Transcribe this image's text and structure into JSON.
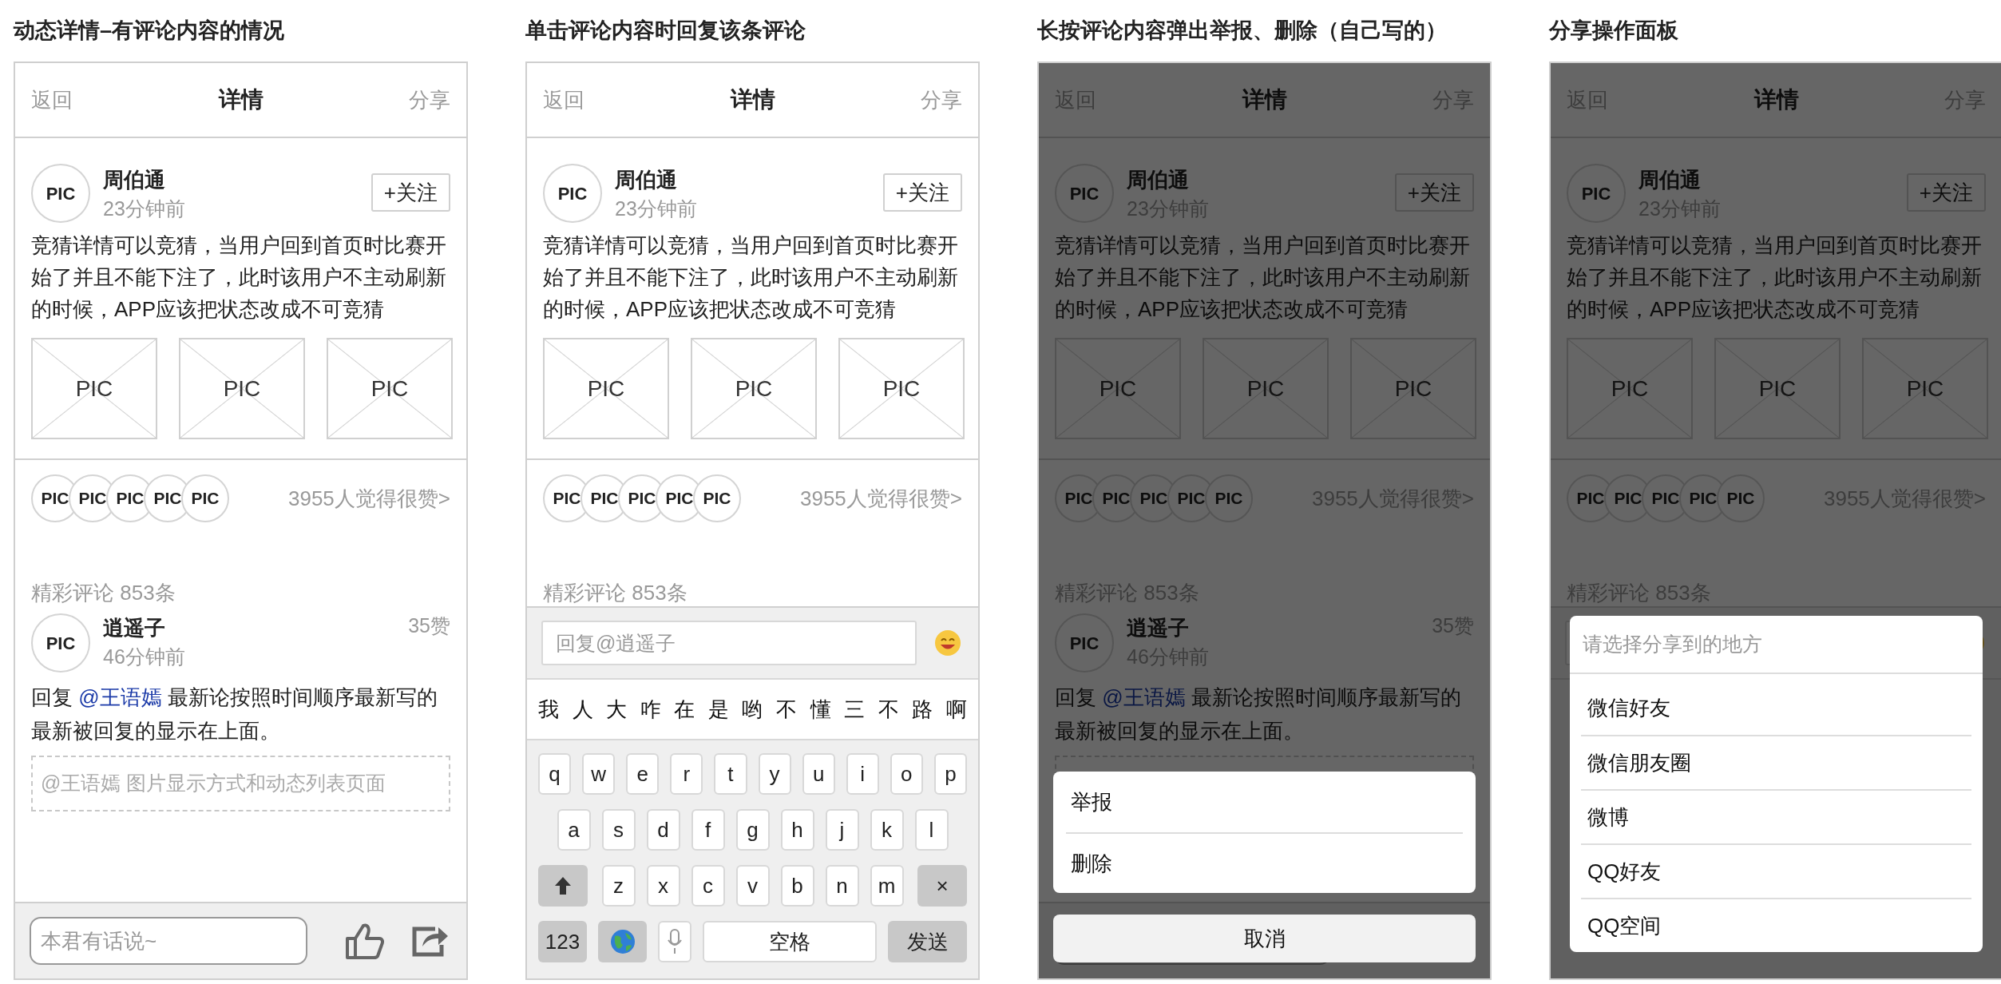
{
  "screens": [
    {
      "caption": "动态详情–有评论内容的情况",
      "nav": {
        "back": "返回",
        "title": "详情",
        "share": "分享"
      },
      "post": {
        "avatar": "PIC",
        "name": "周伯通",
        "time": "23分钟前",
        "follow": "+关注",
        "text": "竞猜详情可以竞猜，当用户回到首页时比赛开始了并且不能下注了，此时该用户不主动刷新的时候，APP应该把状态改成不可竞猜",
        "images": [
          "PIC",
          "PIC",
          "PIC"
        ]
      },
      "likes": {
        "avatars": [
          "PIC",
          "PIC",
          "PIC",
          "PIC",
          "PIC"
        ],
        "summary": "3955人觉得很赞>"
      },
      "comments_header": "精彩评论 853条",
      "comment": {
        "avatar": "PIC",
        "name": "逍遥子",
        "time": "46分钟前",
        "likes": "35赞",
        "prefix": "回复",
        "mention": "@王语嫣",
        "rest": "最新论按照时间顺序最新写的最新被回复的显示在上面。",
        "quote": "@王语嫣 图片显示方式和动态列表页面"
      },
      "bottom": {
        "kind": "comment_bar",
        "placeholder": "本君有话说~"
      }
    },
    {
      "caption": "单击评论内容时回复该条评论",
      "nav": {
        "back": "返回",
        "title": "详情",
        "share": "分享"
      },
      "post": {
        "avatar": "PIC",
        "name": "周伯通",
        "time": "23分钟前",
        "follow": "+关注",
        "text": "竞猜详情可以竞猜，当用户回到首页时比赛开始了并且不能下注了，此时该用户不主动刷新的时候，APP应该把状态改成不可竞猜",
        "images": [
          "PIC",
          "PIC",
          "PIC"
        ]
      },
      "likes": {
        "avatars": [
          "PIC",
          "PIC",
          "PIC",
          "PIC",
          "PIC"
        ],
        "summary": "3955人觉得很赞>"
      },
      "comments_header": "精彩评论 853条",
      "bottom": {
        "kind": "keyboard",
        "placeholder": "回复@逍遥子",
        "candidates": [
          "我",
          "人",
          "大",
          "咋",
          "在",
          "是",
          "哟",
          "不",
          "懂",
          "三",
          "不",
          "路",
          "啊"
        ],
        "rows": [
          [
            "q",
            "w",
            "e",
            "r",
            "t",
            "y",
            "u",
            "i",
            "o",
            "p"
          ],
          [
            "a",
            "s",
            "d",
            "f",
            "g",
            "h",
            "j",
            "k",
            "l"
          ],
          [
            "z",
            "x",
            "c",
            "v",
            "b",
            "n",
            "m"
          ]
        ],
        "delete": "×",
        "numbers": "123",
        "space": "空格",
        "send": "发送"
      }
    },
    {
      "caption": "长按评论内容弹出举报、删除（自己写的）",
      "nav": {
        "back": "返回",
        "title": "详情",
        "share": "分享"
      },
      "post": {
        "avatar": "PIC",
        "name": "周伯通",
        "time": "23分钟前",
        "follow": "+关注",
        "text": "竞猜详情可以竞猜，当用户回到首页时比赛开始了并且不能下注了，此时该用户不主动刷新的时候，APP应该把状态改成不可竞猜",
        "images": [
          "PIC",
          "PIC",
          "PIC"
        ]
      },
      "likes": {
        "avatars": [
          "PIC",
          "PIC",
          "PIC",
          "PIC",
          "PIC"
        ],
        "summary": "3955人觉得很赞>"
      },
      "comments_header": "精彩评论 853条",
      "comment": {
        "avatar": "PIC",
        "name": "逍遥子",
        "time": "46分钟前",
        "likes": "35赞",
        "prefix": "回复",
        "mention": "@王语嫣",
        "rest": "最新论按照时间顺序最新写的最新被回复的显示在上面。",
        "quote_box": true
      },
      "bottom": {
        "kind": "comment_bar"
      },
      "overlay": {
        "kind": "action_sheet",
        "items": [
          "举报",
          "删除"
        ],
        "cancel": "取消"
      }
    },
    {
      "caption": "分享操作面板",
      "nav": {
        "back": "返回",
        "title": "详情",
        "share": "分享"
      },
      "post": {
        "avatar": "PIC",
        "name": "周伯通",
        "time": "23分钟前",
        "follow": "+关注",
        "text": "竞猜详情可以竞猜，当用户回到首页时比赛开始了并且不能下注了，此时该用户不主动刷新的时候，APP应该把状态改成不可竞猜",
        "images": [
          "PIC",
          "PIC",
          "PIC"
        ]
      },
      "likes": {
        "avatars": [
          "PIC",
          "PIC",
          "PIC",
          "PIC",
          "PIC"
        ],
        "summary": "3955人觉得很赞>"
      },
      "comments_header": "精彩评论 853条",
      "bottom": {
        "kind": "keyboard"
      },
      "overlay": {
        "kind": "share_sheet",
        "title": "请选择分享到的地方",
        "items": [
          "微信好友",
          "微信朋友圈",
          "微博",
          "QQ好友",
          "QQ空间"
        ]
      }
    }
  ]
}
